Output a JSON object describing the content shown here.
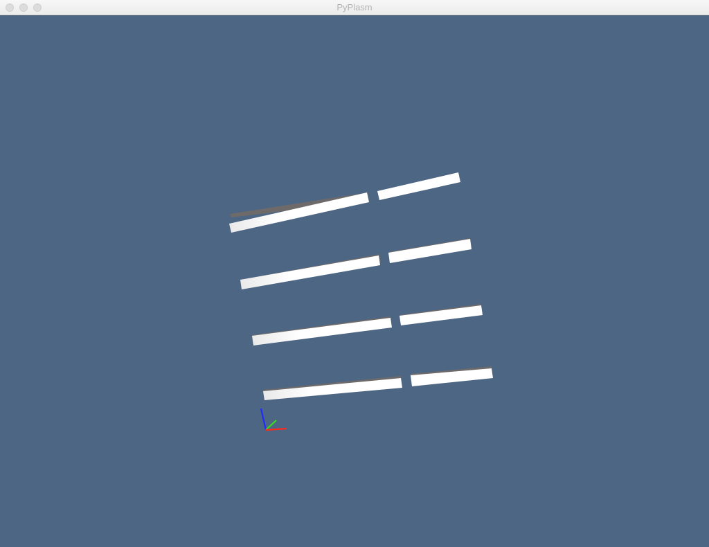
{
  "window": {
    "title": "PyPlasm",
    "controls": [
      "close",
      "minimize",
      "zoom"
    ]
  },
  "viewport": {
    "background_color": "#4d6684",
    "object_color": "#ffffff",
    "object_side_color": "#6e6a6a",
    "axis_colors": {
      "x": "#ff2a1a",
      "y": "#39e021",
      "z": "#1f2bff"
    },
    "scene": {
      "rows": 4,
      "bars_per_row": 2
    }
  }
}
